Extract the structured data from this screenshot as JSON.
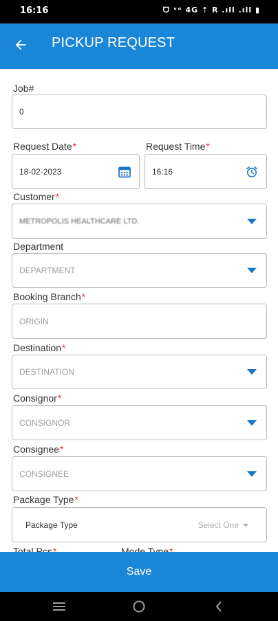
{
  "status_bar": {
    "time": "16:16",
    "indicators": "ᗜ ᵛᵒ 4G ⇡ R .ıll .ıll ▮"
  },
  "header": {
    "title": "PICKUP REQUEST",
    "back_icon": "arrow-left-icon"
  },
  "form": {
    "job": {
      "label": "Job#",
      "value": "0"
    },
    "request_date": {
      "label": "Request Date",
      "required_mark": "*",
      "value": "18-02-2023",
      "icon": "calendar-icon"
    },
    "request_time": {
      "label": "Request Time",
      "required_mark": "*",
      "value": "16:16",
      "icon": "alarm-clock-icon"
    },
    "customer": {
      "label": "Customer",
      "required_mark": "*",
      "value": "METROPOLIS HEALTHCARE LTD."
    },
    "department": {
      "label": "Department",
      "placeholder": "DEPARTMENT"
    },
    "booking_branch": {
      "label": "Booking Branch",
      "required_mark": "*",
      "placeholder": "ORIGIN"
    },
    "destination": {
      "label": "Destination",
      "required_mark": "*",
      "placeholder": "DESTINATION"
    },
    "consignor": {
      "label": "Consignor",
      "required_mark": "*",
      "placeholder": "CONSIGNOR"
    },
    "consignee": {
      "label": "Consignee",
      "required_mark": "*",
      "placeholder": "CONSIGNEE"
    },
    "package_type": {
      "label": "Package Type",
      "required_mark": "*",
      "inner_label": "Package Type",
      "select_text": "Select One"
    },
    "total_pcs": {
      "label": "Total Pcs",
      "required_mark": "*"
    },
    "mode_type": {
      "label": "Mode Type",
      "required_mark": "*"
    }
  },
  "footer": {
    "save_label": "Save"
  },
  "colors": {
    "primary": "#1a86d8",
    "required": "#e53935",
    "dropdown_arrow": "#1a75c9"
  }
}
